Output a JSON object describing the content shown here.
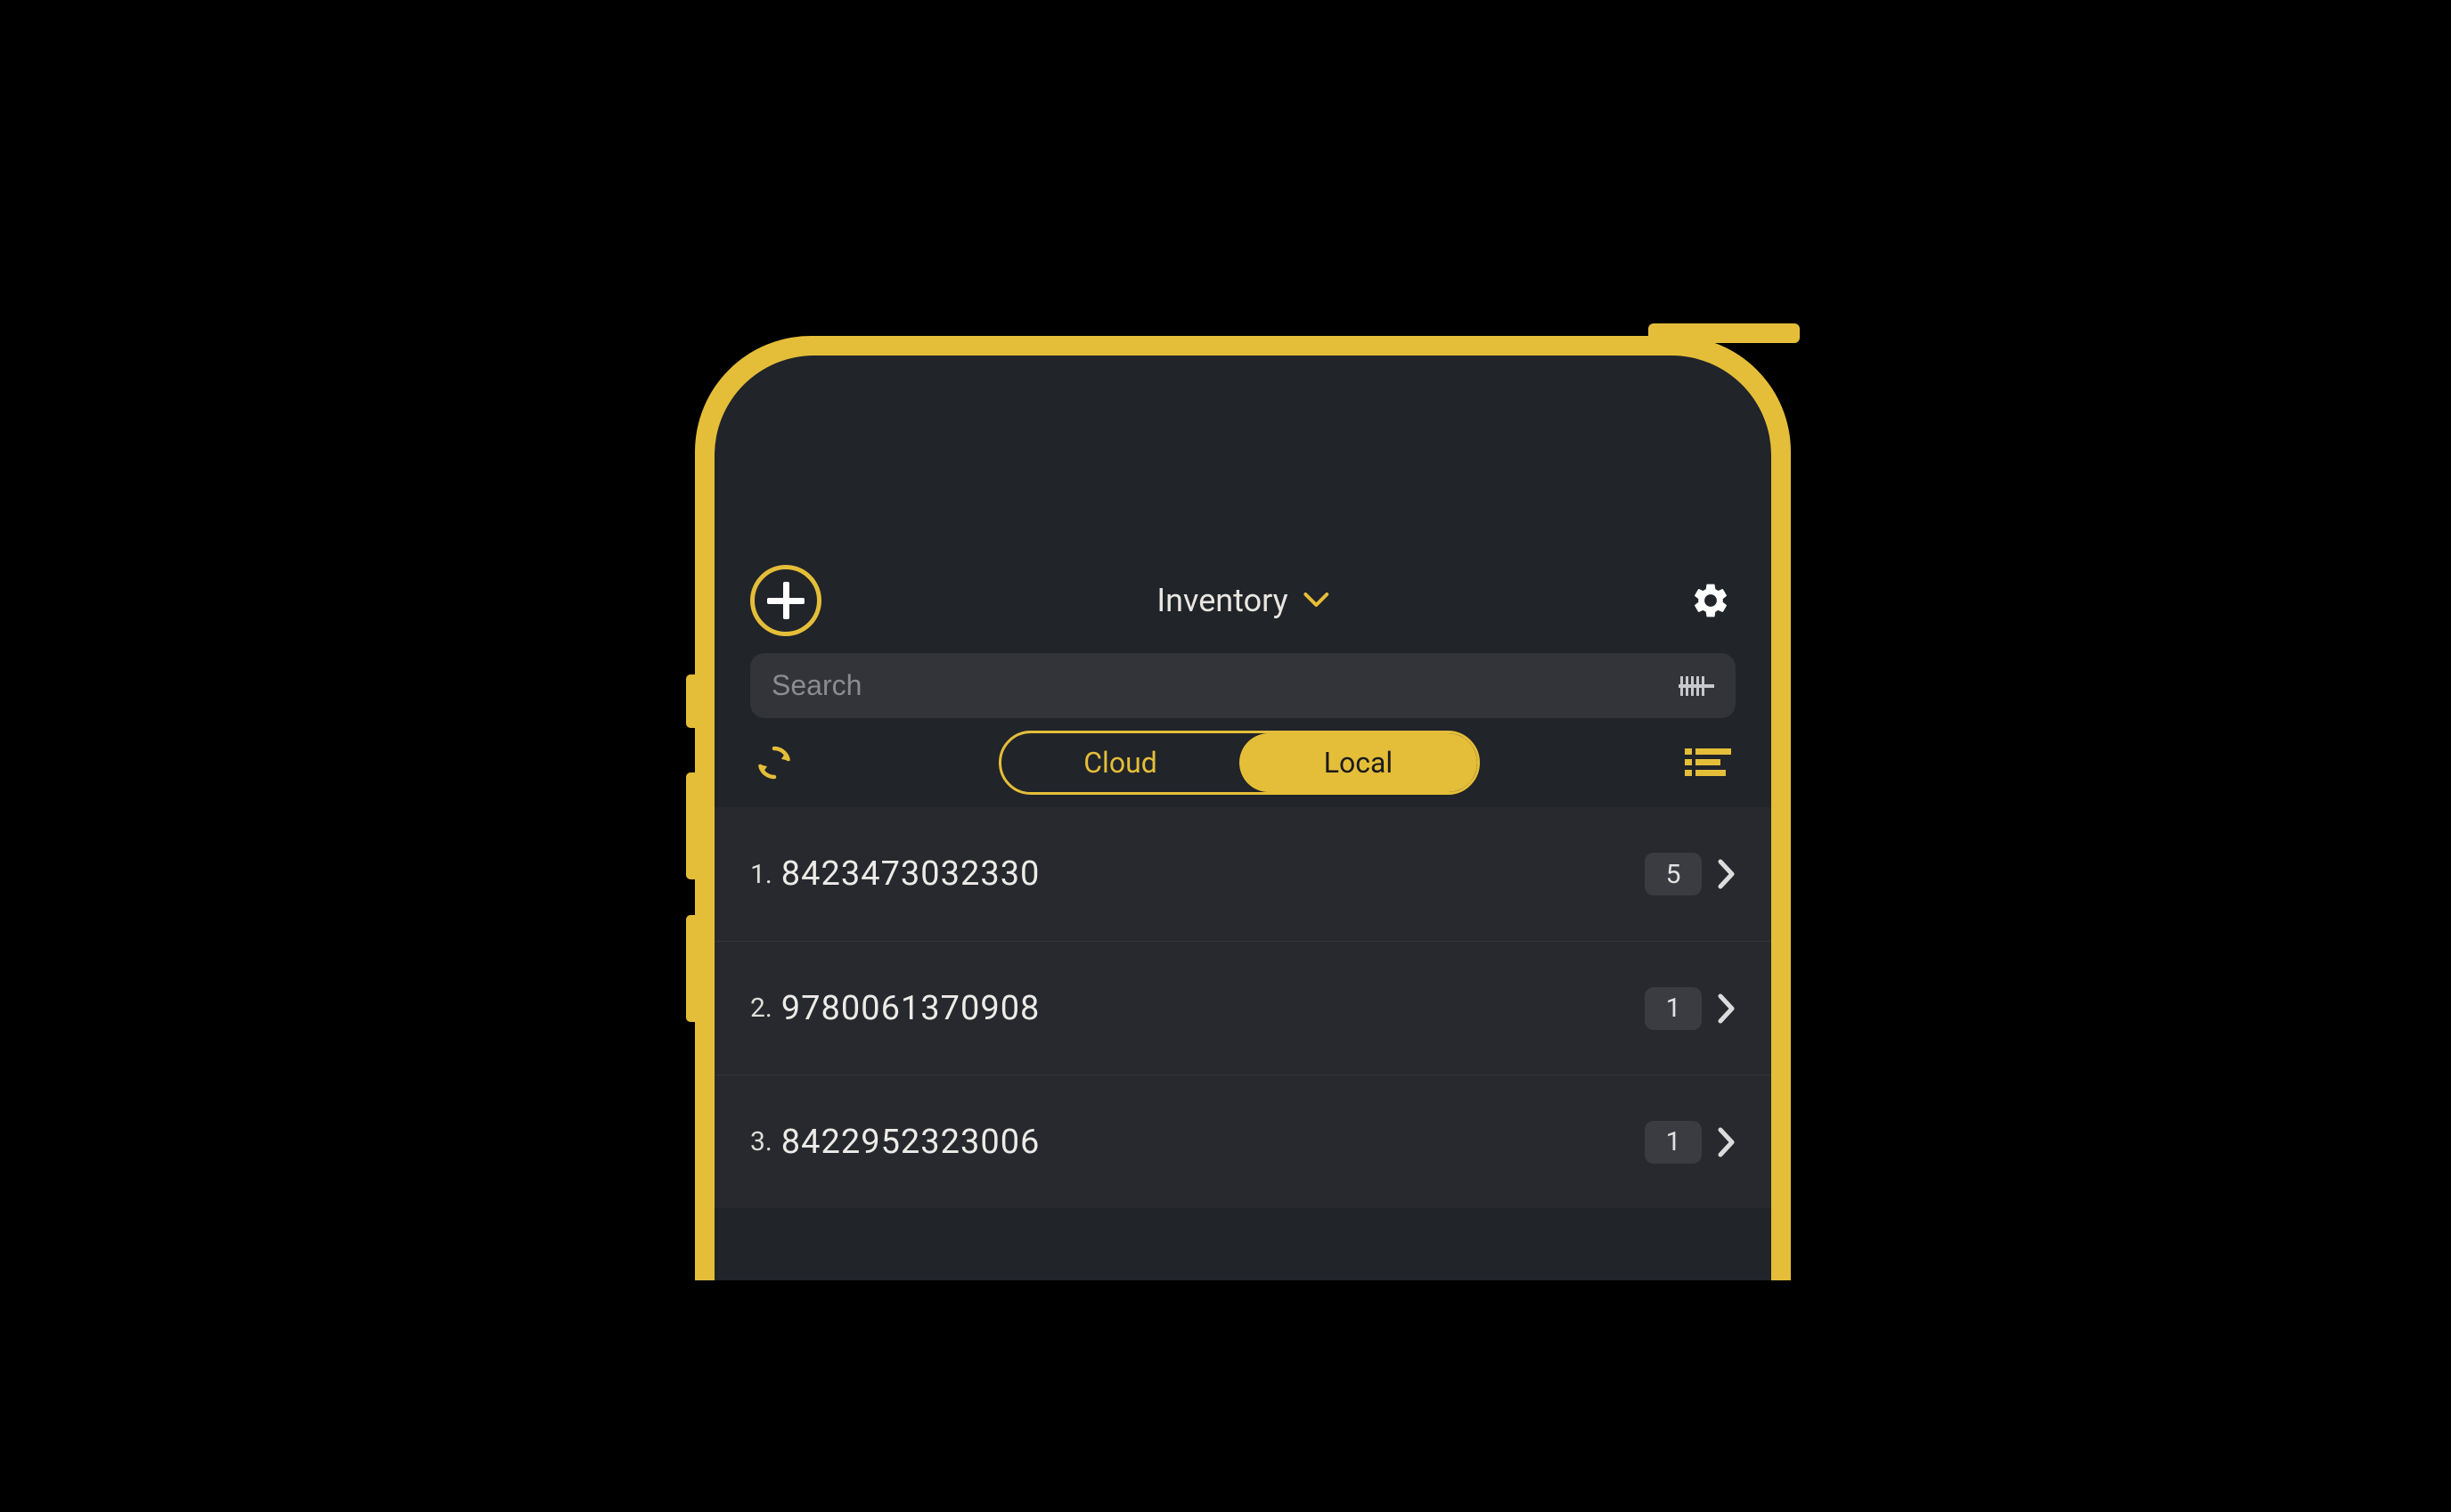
{
  "header": {
    "title": "Inventory"
  },
  "search": {
    "placeholder": "Search",
    "value": ""
  },
  "segmented": {
    "cloud_label": "Cloud",
    "local_label": "Local",
    "active": "local"
  },
  "list": {
    "items": [
      {
        "index": "1.",
        "code": "8423473032330",
        "count": "5"
      },
      {
        "index": "2.",
        "code": "9780061370908",
        "count": "1"
      },
      {
        "index": "3.",
        "code": "8422952323006",
        "count": "1"
      }
    ]
  },
  "colors": {
    "accent": "#e5be39",
    "screen_bg": "#212429",
    "row_bg": "#27292e"
  }
}
